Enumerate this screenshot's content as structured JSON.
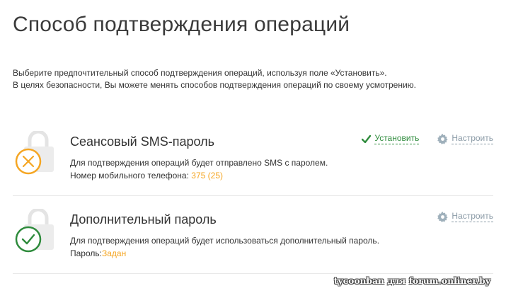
{
  "page": {
    "title": "Способ подтверждения операций",
    "intro_line1": "Выберите предпочтительный способ подтверждения операций, используя поле «Установить».",
    "intro_line2": "В целях безопасности, Вы можете менять способов подтверждения операций по своему усмотрению."
  },
  "methods": [
    {
      "title": "Сеансовый SMS-пароль",
      "desc": "Для подтверждения операций будет отправлено SMS с паролем.",
      "detail_label": "Номер мобильного телефона:",
      "detail_value": "375 (25)",
      "status_icon": "x-circle-icon",
      "status_color": "#f5a623",
      "install_label": "Установить",
      "configure_label": "Настроить"
    },
    {
      "title": "Дополнительный пароль",
      "desc": "Для подтверждения операций будет использоваться дополнительный пароль.",
      "detail_label": "Пароль:",
      "detail_value": "Задан",
      "status_icon": "check-circle-icon",
      "status_color": "#2e8b3c",
      "configure_label": "Настроить"
    }
  ],
  "colors": {
    "accent": "#f5a623",
    "success": "#2e8b3c",
    "link_muted": "#8a9aa6"
  },
  "watermark": "tycoonban для forum.onliner.by"
}
